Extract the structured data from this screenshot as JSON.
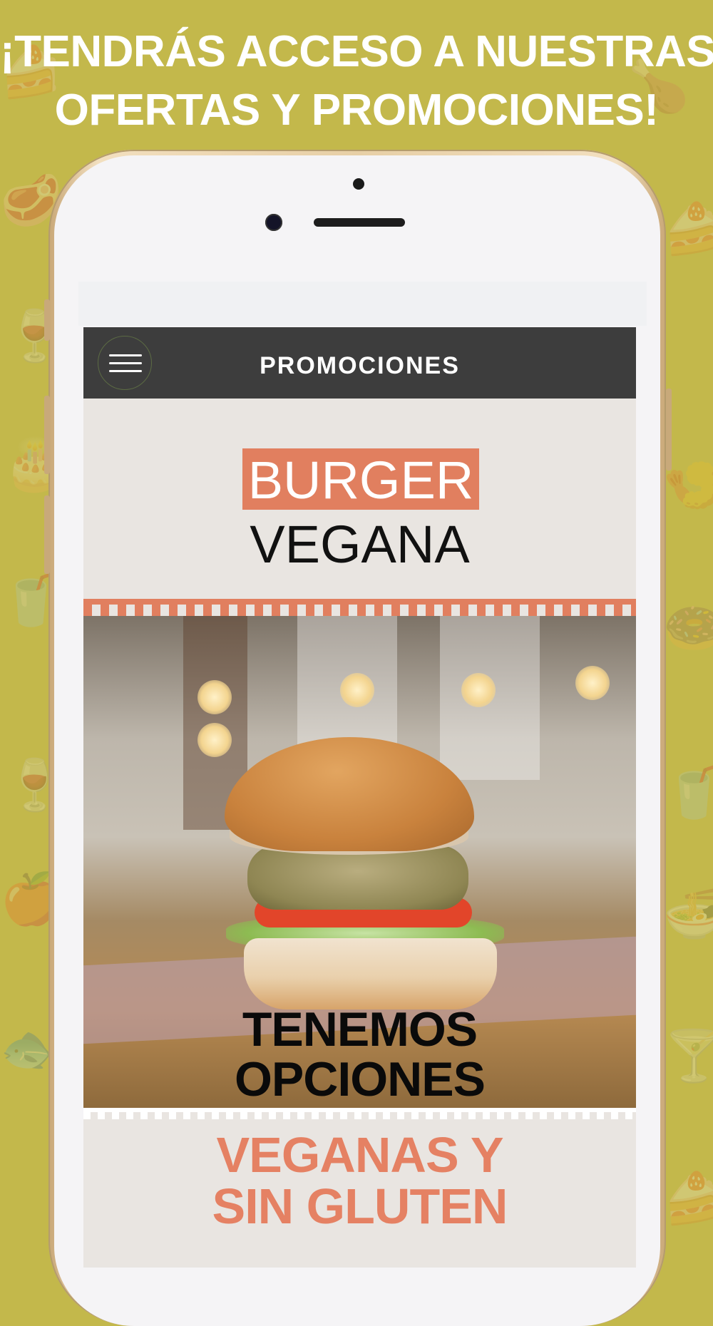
{
  "headline": {
    "line1": "¡TENDRÁS ACCESO A NUESTRAS",
    "line2": "OFERTAS Y PROMOCIONES!"
  },
  "app": {
    "title": "PROMOCIONES",
    "menu_icon": "hamburger-menu-icon"
  },
  "promo": {
    "tag": "BURGER",
    "subtitle": "VEGANA",
    "overlay_line1": "TENEMOS",
    "overlay_line2": "OPCIONES",
    "footer_line1": "VEGANAS Y",
    "footer_line2": "SIN GLUTEN"
  },
  "colors": {
    "background": "#c3b84b",
    "accent": "#e17f5f",
    "appbar": "#3d3d3d",
    "screen": "#e9e5e1"
  },
  "decor_icons": [
    "cake-icon",
    "wine-glass-icon",
    "steak-icon",
    "apple-icon",
    "cocktail-icon",
    "fish-icon",
    "drink-icon"
  ]
}
